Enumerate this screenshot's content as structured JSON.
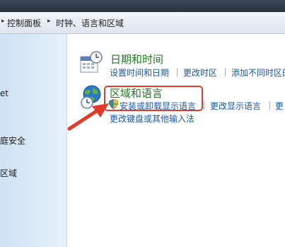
{
  "breadcrumb": {
    "items": [
      "控制面板",
      "时钟、语言和区域"
    ]
  },
  "sidebar": {
    "items": [
      {
        "label": "et"
      },
      {
        "label": "庭安全"
      },
      {
        "label": "区域"
      }
    ]
  },
  "categories": [
    {
      "title": "日期和时间",
      "icon": "calendar-clock-icon",
      "links": [
        "设置时间和日期",
        "更改时区",
        "添加不同时区的"
      ]
    },
    {
      "title": "区域和语言",
      "icon": "globe-clock-icon",
      "links": [
        "安装或卸载显示语言",
        "更改显示语言",
        "更"
      ],
      "links2": [
        "更改键盘或其他输入法"
      ]
    }
  ],
  "colors": {
    "highlight": "#e13b2b",
    "category_title": "#1e7a1e",
    "link": "#1a55b0"
  }
}
